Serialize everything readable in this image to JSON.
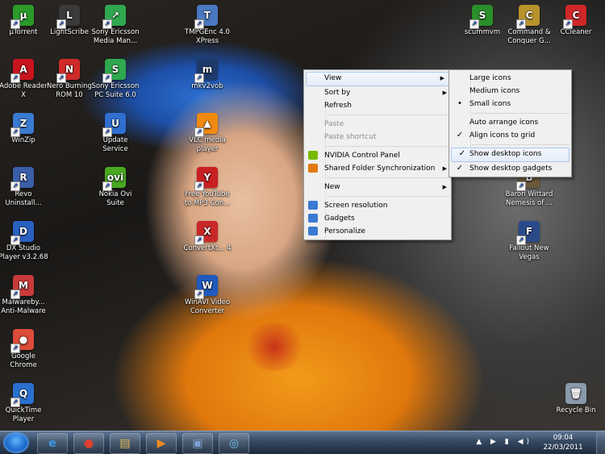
{
  "desktop_icons": [
    {
      "label": "µTorrent",
      "color": "#2b9a2a",
      "glyph": "µ"
    },
    {
      "label": "LightScribe",
      "color": "#3a3a3a",
      "glyph": "L"
    },
    {
      "label": "Sony Ericsson Media Man...",
      "color": "#2fa84f",
      "glyph": "↗"
    },
    {
      "label": "TMPGEnc 4.0 XPress",
      "color": "#4a78c0",
      "glyph": "T"
    },
    {
      "label": "scummvm",
      "color": "#2a8f2a",
      "glyph": "S"
    },
    {
      "label": "Command & Conquer G...",
      "color": "#b8922b",
      "glyph": "C"
    },
    {
      "label": "CCleaner",
      "color": "#d02828",
      "glyph": "C"
    },
    {
      "label": "Adobe Reader X",
      "color": "#c8141e",
      "glyph": "A"
    },
    {
      "label": "Nero Burning ROM 10",
      "color": "#cf2a2a",
      "glyph": "N"
    },
    {
      "label": "Sony Ericsson PC Suite 6.0",
      "color": "#2fa84f",
      "glyph": "S"
    },
    {
      "label": "mkv2vob",
      "color": "#1e3a6a",
      "glyph": "m"
    },
    {
      "label": "WinZip",
      "color": "#3a7ad0",
      "glyph": "Z"
    },
    {
      "label": "Update Service",
      "color": "#2f6fd0",
      "glyph": "U"
    },
    {
      "label": "VLC media player",
      "color": "#f08a10",
      "glyph": "▲"
    },
    {
      "label": "Revo Uninstall...",
      "color": "#3a5ea8",
      "glyph": "R"
    },
    {
      "label": "Nokia Ovi Suite",
      "color": "#48a820",
      "glyph": "ovi"
    },
    {
      "label": "Free YouTube to MP3 Con...",
      "color": "#c82020",
      "glyph": "Y"
    },
    {
      "label": "Baron Wittard Nemesis of ...",
      "color": "#6a5a3a",
      "glyph": "B"
    },
    {
      "label": "DX Studio Player v3.2.68",
      "color": "#2a60c0",
      "glyph": "D"
    },
    {
      "label": "ConvertXt... 4",
      "color": "#c82828",
      "glyph": "X"
    },
    {
      "label": "Fallout New Vegas",
      "color": "#2a4a8a",
      "glyph": "F"
    },
    {
      "label": "Malwareby... Anti-Malware",
      "color": "#c83a3a",
      "glyph": "M"
    },
    {
      "label": "WinAVI Video Converter",
      "color": "#1e5ac0",
      "glyph": "W"
    },
    {
      "label": "Google Chrome",
      "color": "#dd4b39",
      "glyph": "●"
    },
    {
      "label": "QuickTime Player",
      "color": "#2a70d0",
      "glyph": "Q"
    },
    {
      "label": "Recycle Bin",
      "color": "#8a9aaa",
      "glyph": "🗑"
    }
  ],
  "context_menu": {
    "items": [
      {
        "label": "View",
        "has_submenu": true,
        "state": "hover"
      },
      {
        "label": "Sort by",
        "has_submenu": true
      },
      {
        "label": "Refresh"
      },
      {
        "label": "Paste",
        "state": "disabled"
      },
      {
        "label": "Paste shortcut",
        "state": "disabled"
      },
      {
        "label": "NVIDIA Control Panel",
        "icon": "nvidia-icon",
        "icon_color": "#76b900"
      },
      {
        "label": "Shared Folder Synchronization",
        "icon": "sync-icon",
        "icon_color": "#e07a10",
        "has_submenu": true
      },
      {
        "label": "New",
        "has_submenu": true
      },
      {
        "label": "Screen resolution",
        "icon": "monitor-icon",
        "icon_color": "#3a7ad0"
      },
      {
        "label": "Gadgets",
        "icon": "gadgets-icon",
        "icon_color": "#3a7ad0"
      },
      {
        "label": "Personalize",
        "icon": "personalize-icon",
        "icon_color": "#3a7ad0"
      }
    ]
  },
  "view_submenu": {
    "items": [
      {
        "label": "Large icons"
      },
      {
        "label": "Medium icons"
      },
      {
        "label": "Small icons",
        "mark": "•"
      },
      {
        "label": "Auto arrange icons"
      },
      {
        "label": "Align icons to grid",
        "mark": "✓"
      },
      {
        "label": "Show desktop icons",
        "mark": "✓",
        "state": "hover"
      },
      {
        "label": "Show desktop gadgets",
        "mark": "✓"
      }
    ]
  },
  "taskbar": {
    "pinned": [
      {
        "name": "internet-explorer-icon",
        "glyph": "e",
        "color": "#3a9ae8"
      },
      {
        "name": "chrome-icon",
        "glyph": "●",
        "color": "#e04030"
      },
      {
        "name": "explorer-folder-icon",
        "glyph": "▤",
        "color": "#e8c050"
      },
      {
        "name": "media-player-icon",
        "glyph": "▶",
        "color": "#f08a20"
      },
      {
        "name": "pictures-icon",
        "glyph": "▣",
        "color": "#7aa0d0"
      },
      {
        "name": "network-icon",
        "glyph": "◎",
        "color": "#70c0f0"
      }
    ],
    "tray_icons": "▲ ▶ ▮ ◀)",
    "clock_time": "09:04",
    "clock_date": "22/03/2011"
  }
}
